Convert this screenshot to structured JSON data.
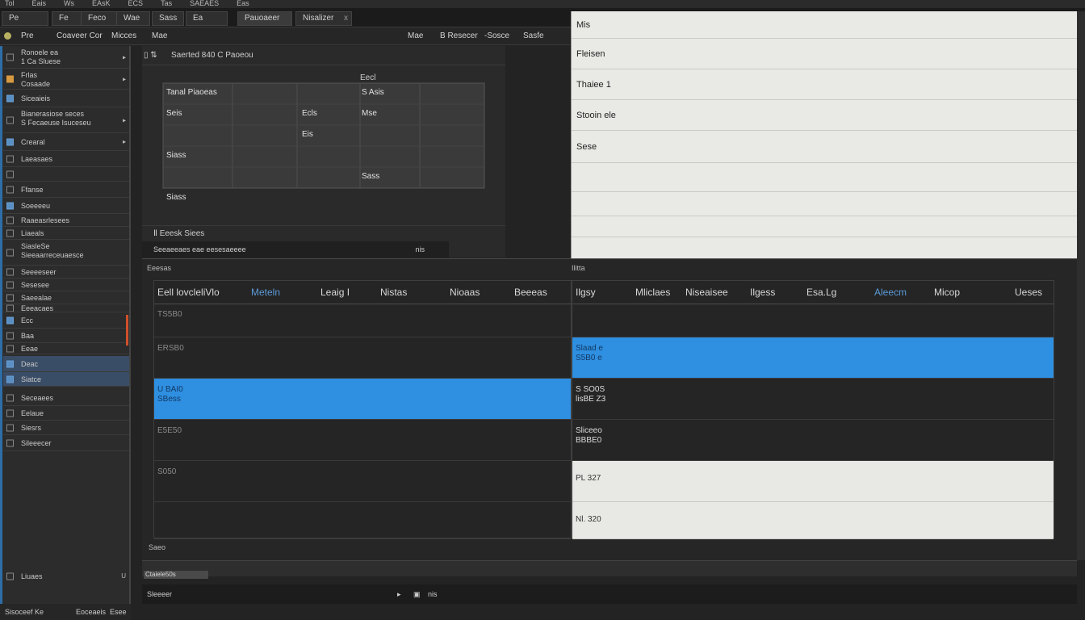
{
  "menu": [
    "Tol",
    "Eais",
    "Ws",
    "EAsK",
    "ECS",
    "Tas",
    "SAEAES",
    "Eas"
  ],
  "tabs": [
    {
      "label": "Pe",
      "close": ""
    },
    {
      "label": "Fe",
      "close": ""
    },
    {
      "label": "Feco",
      "close": ""
    },
    {
      "label": "Wae",
      "close": ""
    },
    {
      "label": "Sass",
      "close": ""
    },
    {
      "label": "Ea",
      "close": ""
    },
    {
      "label": "Pauoaeer",
      "close": ""
    },
    {
      "label": "Nisalizer",
      "close": "x"
    }
  ],
  "toolbar": {
    "left": [
      "Pre",
      "Coaveer Cor",
      "Micces",
      "Mae"
    ],
    "right": [
      "Mae",
      "B Resecer",
      "-Sosce",
      "Sasfe"
    ]
  },
  "sidebar": {
    "items": [
      {
        "label": "Ronoele ea\n1 Ca Sluese",
        "caret": "▸"
      },
      {
        "label": "Frlas\nCosaade",
        "caret": "▸"
      },
      {
        "label": "Siceaieis",
        "caret": ""
      },
      {
        "label": "Bianerasiose seces\nS Fecaeuse Isuceseu",
        "caret": "▸"
      },
      {
        "label": "Crearal",
        "caret": "▸"
      },
      {
        "label": "Laeasaes",
        "caret": ""
      },
      {
        "label": "",
        "caret": ""
      },
      {
        "label": "Ffanse",
        "caret": ""
      },
      {
        "label": "Soeeeeu",
        "caret": ""
      },
      {
        "label": "Raaeasrlesees",
        "caret": ""
      },
      {
        "label": "Liaeals",
        "caret": ""
      },
      {
        "label": "SiasleSe\nSieeaarreceuaesce",
        "caret": ""
      },
      {
        "label": "Seeeeseer",
        "caret": ""
      },
      {
        "label": "Sesesee",
        "caret": ""
      },
      {
        "label": "Saeealae",
        "caret": ""
      },
      {
        "label": "Eeeacaes",
        "caret": ""
      },
      {
        "label": "Ecc",
        "caret": ""
      },
      {
        "label": "Baa",
        "caret": ""
      },
      {
        "label": "Eeae",
        "caret": ""
      },
      {
        "label": "Deac",
        "caret": ""
      },
      {
        "label": "Siatce",
        "caret": ""
      },
      {
        "label": "Seceaees",
        "caret": ""
      },
      {
        "label": "Eelaue",
        "caret": ""
      },
      {
        "label": "Siesrs",
        "caret": ""
      },
      {
        "label": "Sileeecer",
        "caret": ""
      }
    ],
    "bottom_label": "Liuaes",
    "footer": [
      "Sisoceef Ke",
      "Eoceaeis",
      "Esee"
    ]
  },
  "chart": {
    "header": "Saerted 840 C Paoeou",
    "top_label": "Eecl",
    "foot1": "Eeesk Siees",
    "foot2": "Seeaeeaes eae eesesaeeee",
    "foot2_right": "nis"
  },
  "chart_data": {
    "type": "table",
    "labels": [
      {
        "text": "Tanal Piaoeas",
        "col": 0,
        "row": 0
      },
      {
        "text": "S Asis",
        "col": 2,
        "row": 0
      },
      {
        "text": "Seis",
        "col": 0,
        "row": 1
      },
      {
        "text": "Ecls",
        "col": 1,
        "row": 1
      },
      {
        "text": "Mse",
        "col": 2,
        "row": 1
      },
      {
        "text": "Eis",
        "col": 1,
        "row": 2
      },
      {
        "text": "Siass",
        "col": 0,
        "row": 3
      },
      {
        "text": "Sass",
        "col": 2,
        "row": 4
      },
      {
        "text": "Siass",
        "col": 0,
        "row": 5
      }
    ]
  },
  "props": {
    "rows": [
      "Mis",
      "Fleisen",
      "Thaiee  1",
      "Stooin ele",
      "Sese",
      "",
      "",
      ""
    ]
  },
  "bottom": {
    "left_title": "Eeesas",
    "right_title": "Ilitta",
    "left_headers": [
      "Eell lovcleliVlo",
      "Meteln",
      "Leaig I",
      "Nistas"
    ],
    "right_left_header": "Nioaas",
    "mid_headers": [
      "Beeeas",
      "Ilgsy"
    ],
    "right_headers": [
      "Mliclaes",
      "Niseaisee",
      "Ilgess",
      "Esa.Lg",
      "Aleecm",
      "Micop",
      "Ueses"
    ],
    "left_rows": [
      {
        "text": "TS5B0",
        "state": "normal"
      },
      {
        "text": "ERSB0",
        "state": "normal"
      },
      {
        "text": "U BAI0\nSBess",
        "state": "sel"
      },
      {
        "text": "E5E50",
        "state": "normal"
      },
      {
        "text": "S050",
        "state": "normal"
      },
      {
        "text": "",
        "state": "normal"
      }
    ],
    "right_rows": [
      {
        "text": "",
        "state": "normal"
      },
      {
        "text": "Slaad e\nS5B0 e",
        "state": "sel"
      },
      {
        "text": "S SO0S\nlisBE Z3",
        "state": "dark"
      },
      {
        "text": "Sliceeo\nBBBE0",
        "state": "dark"
      },
      {
        "text": "PL 327",
        "state": "white"
      },
      {
        "text": "Nl. 320",
        "state": "white"
      }
    ],
    "footer_label": "Saeo"
  },
  "status": {
    "chip": "Ctaiele50s",
    "left": "Sleeeer",
    "right": "nis"
  }
}
